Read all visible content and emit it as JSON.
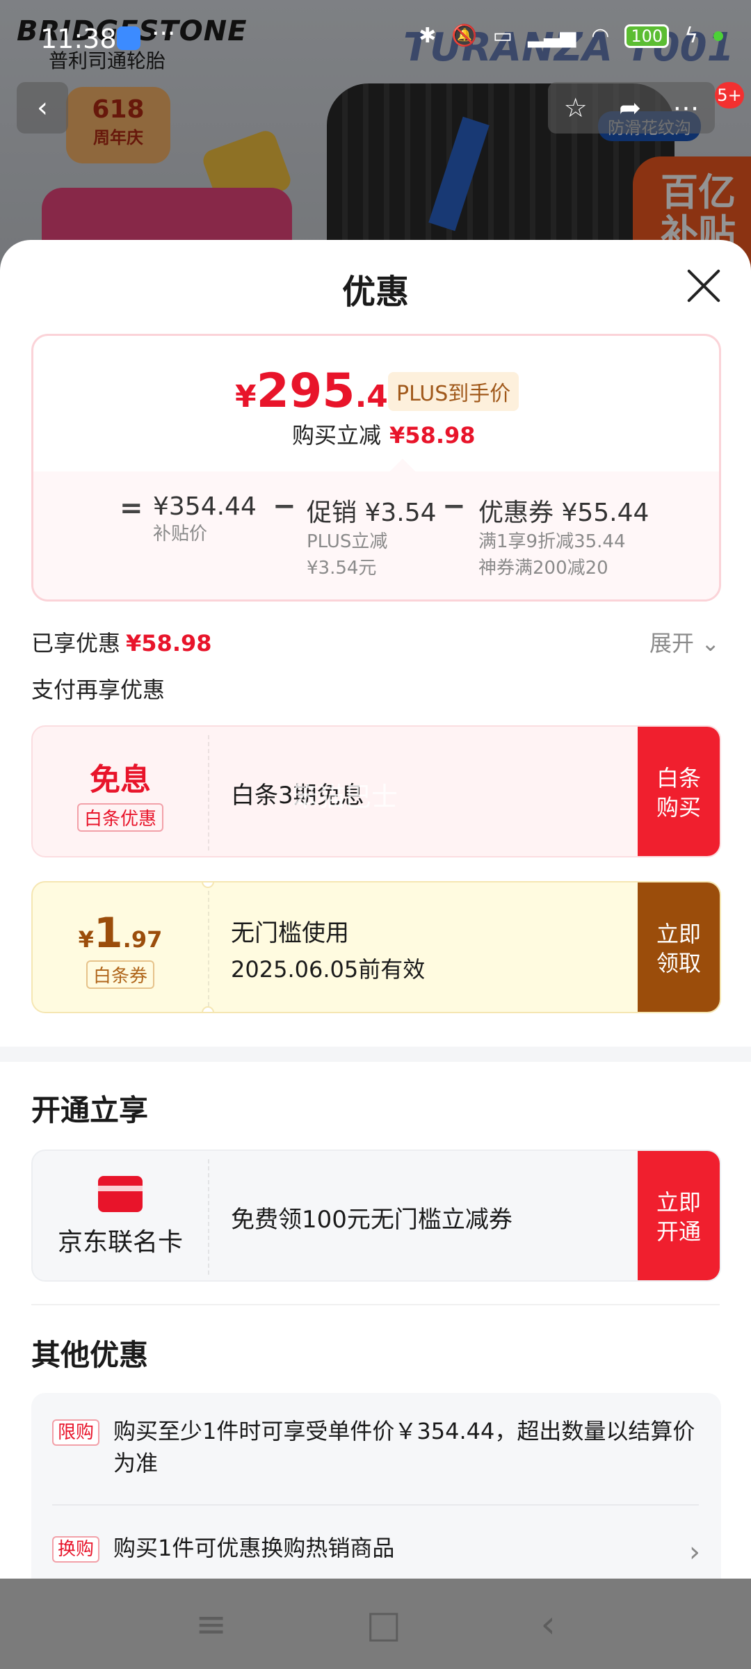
{
  "status_bar": {
    "time": "11:38",
    "more": "···",
    "battery": "100"
  },
  "background": {
    "brand": "BRIDGESTONE",
    "brand_sub": "普利司通轮胎",
    "model": "TURANZA T001",
    "badge_618": "618",
    "badge_618_sub": "周年庆",
    "anti_skid": "防滑花纹沟",
    "subsidy": "百亿补贴",
    "cart_count": "5+"
  },
  "sheet": {
    "title": "优惠",
    "price_card": {
      "currency": "¥",
      "price_int": "295",
      "price_dec": ".46",
      "plus_tag": "PLUS到手价",
      "save_label": "购买立减",
      "save_value": "¥58.98",
      "breakdown": {
        "eq": "=",
        "subsidy_price": "¥354.44",
        "subsidy_label": "补贴价",
        "minus1": "−",
        "promo_main": "促销 ¥3.54",
        "promo_sub1": "PLUS立减",
        "promo_sub2": "¥3.54元",
        "minus2": "−",
        "coupon_main": "优惠券 ¥55.44",
        "coupon_sub1": "满1享9折减35.44",
        "coupon_sub2": "神券满200减20"
      }
    },
    "enjoyed_label": "已享优惠",
    "enjoyed_value": "¥58.98",
    "expand_label": "展开",
    "pay_more_label": "支付再享优惠",
    "offers": [
      {
        "left_big": "免息",
        "left_tag": "白条优惠",
        "mid_text": "白条3期免息",
        "btn_line1": "白条",
        "btn_line2": "购买"
      },
      {
        "amt_currency": "¥",
        "amt_int": "1",
        "amt_dec": ".97",
        "left_tag": "白条券",
        "mid_line1": "无门槛使用",
        "mid_line2": "2025.06.05前有效",
        "btn_line1": "立即",
        "btn_line2": "领取"
      }
    ],
    "watermark": "笨猫巴士",
    "open_section_title": "开通立享",
    "card_offer": {
      "card_label": "京东联名卡",
      "mid_text": "免费领100元无门槛立减券",
      "btn_line1": "立即",
      "btn_line2": "开通"
    },
    "other_section_title": "其他优惠",
    "other_offers": [
      {
        "tag": "限购",
        "text": "购买至少1件时可享受单件价￥354.44，超出数量以结算价为准"
      },
      {
        "tag": "换购",
        "text": "购买1件可优惠换购热销商品"
      }
    ]
  },
  "bottom_nav": {
    "menu": "≡",
    "home": "□",
    "back": "‹"
  }
}
